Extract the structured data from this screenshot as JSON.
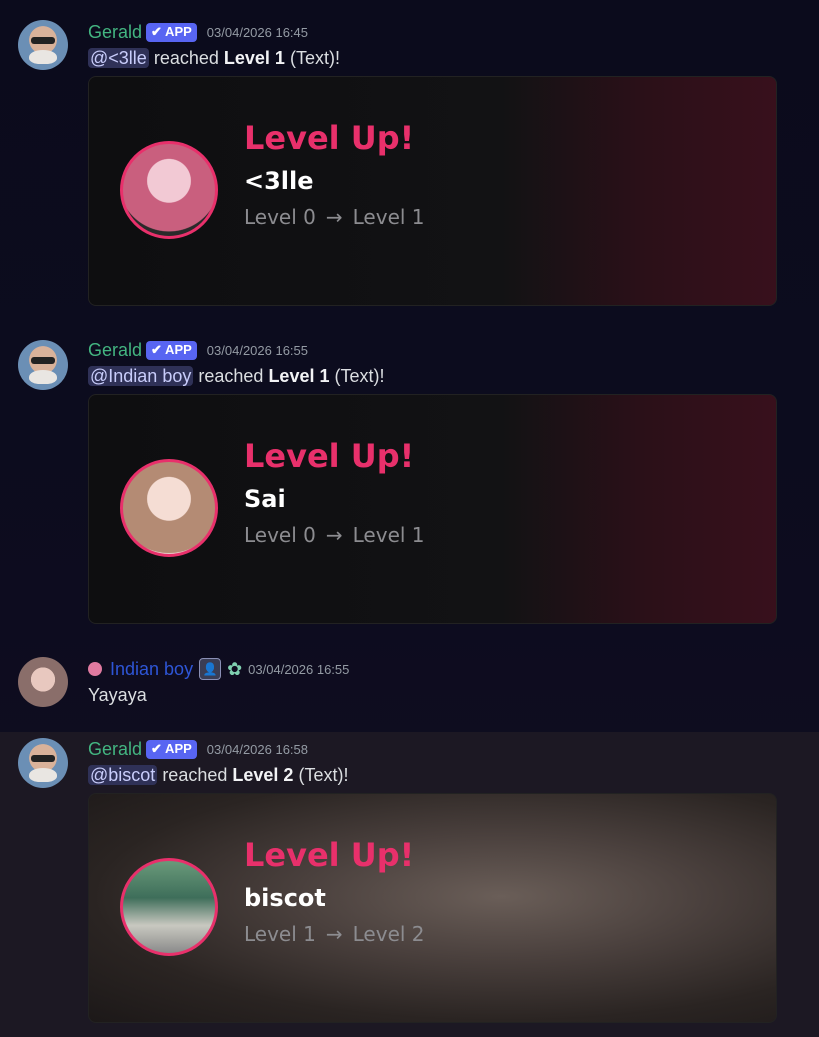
{
  "colors": {
    "accent": "#e8306b",
    "bot_name": "#43b581",
    "user_name": "#2e55d6",
    "app_badge": "#5865f2"
  },
  "messages": [
    {
      "author": "Gerald",
      "badge": "✔ APP",
      "time": "03/04/2026 16:45",
      "mention": "@<3lle",
      "text_pre": "reached",
      "level_bold": "Level 1",
      "text_post": "(Text)!",
      "card": {
        "title": "Level Up!",
        "username": "<3lle",
        "from": "Level 0",
        "arrow": "→",
        "to": "Level 1"
      }
    },
    {
      "author": "Gerald",
      "badge": "✔ APP",
      "time": "03/04/2026 16:55",
      "mention": "@Indian boy",
      "text_pre": "reached",
      "level_bold": "Level 1",
      "text_post": "(Text)!",
      "card": {
        "title": "Level Up!",
        "username": "Sai",
        "from": "Level 0",
        "arrow": "→",
        "to": "Level 1"
      }
    },
    {
      "author": "Indian boy",
      "time": "03/04/2026 16:55",
      "text": "Yayaya",
      "icons": [
        "clock-badge-icon",
        "user-badge-icon",
        "flower-badge-icon"
      ]
    },
    {
      "author": "Gerald",
      "badge": "✔ APP",
      "time": "03/04/2026 16:58",
      "mention": "@biscot",
      "text_pre": "reached",
      "level_bold": "Level 2",
      "text_post": "(Text)!",
      "card": {
        "title": "Level Up!",
        "username": "biscot",
        "from": "Level 1",
        "arrow": "→",
        "to": "Level 2"
      }
    }
  ]
}
